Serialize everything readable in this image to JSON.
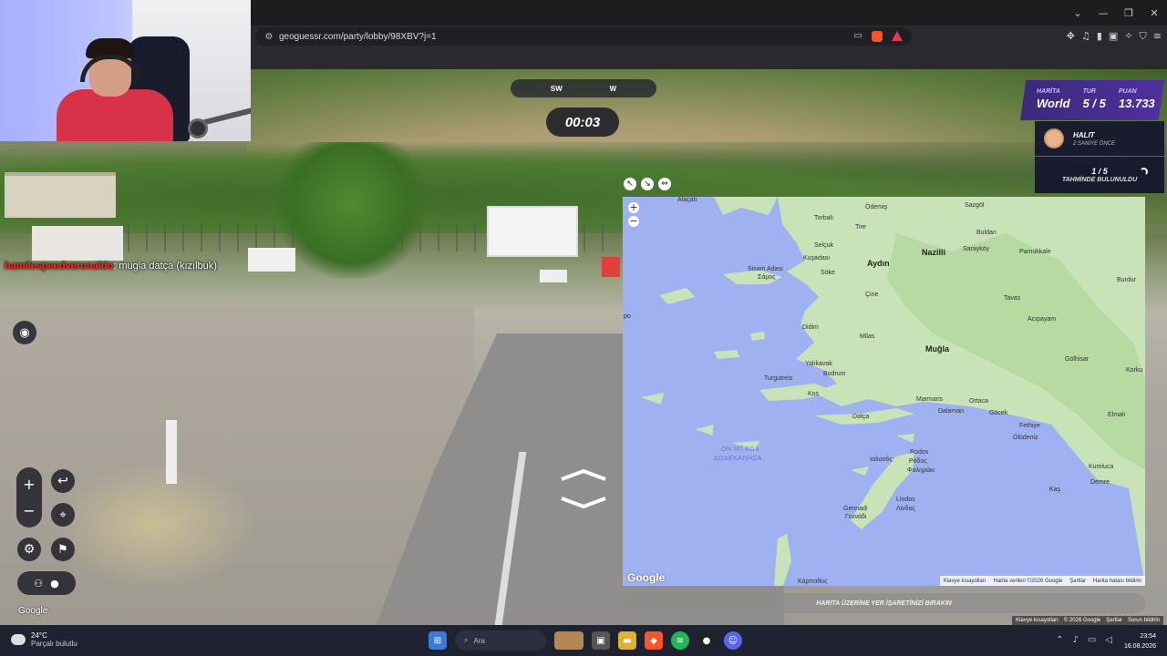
{
  "browser": {
    "url": "geoguessr.com/party/lobby/98XBV?j=1",
    "window_controls": [
      "⌄",
      "—",
      "❐",
      "✕"
    ],
    "shield_badge": "9",
    "ext_icons": [
      "puzzle-icon",
      "music-icon",
      "sidebar-icon",
      "wallet-icon",
      "sparkle-icon",
      "shield-icon",
      "menu-icon"
    ]
  },
  "game": {
    "compass": [
      "SW",
      "W"
    ],
    "timer": "00:03",
    "hud": {
      "map_label": "HARİTA",
      "map_value": "World",
      "round_label": "TUR",
      "round_value": "5 / 5",
      "score_label": "PUAN",
      "score_value": "13.733"
    },
    "player": {
      "name": "HALIT",
      "time": "2 SANİYE ÖNCE"
    },
    "guesses": {
      "count": "1 / 5",
      "label": "TAHMİNDE BULUNULDU"
    },
    "place_button": "HARİTA ÜZERİNE YER İŞARETİNİZİ BIRAKIN",
    "street_google": "Google",
    "street_footer": [
      "Klavye kısayolları",
      "© 2026 Google",
      "Şartlar",
      "Sorun bildirin"
    ]
  },
  "chat": {
    "user": "hamilespeedveronaldo",
    "message": ": mugla datça (kızılbuk)"
  },
  "map": {
    "google": "Google",
    "footer": [
      "Klavye kısayolları",
      "Harita verileri ©2026 Google",
      "Şartlar",
      "Harita hatası bildirin"
    ],
    "labels": {
      "alacati": "Alaçatı",
      "odemis": "Ödemiş",
      "sazgol": "Sazgöl",
      "torbali": "Torbalı",
      "tire": "Tire",
      "buldan": "Buldan",
      "selcuk": "Selçuk",
      "nazilli": "Nazilli",
      "sarayköy": "Sarayköy",
      "pamukkale": "Pamukkale",
      "kusadasi": "Kuşadası",
      "aydin": "Aydın",
      "sisam": "Sisam Adası",
      "samos": "Σάμος",
      "soke": "Söke",
      "burdur": "Burdur",
      "cine": "Çine",
      "tavas": "Tavas",
      "didim": "Didim",
      "acipayam": "Acıpayam",
      "milas": "Milas",
      "yalikavak": "Yalıkavak",
      "mugla": "Muğla",
      "golhisar": "Gölhisar",
      "turgutreis": "Turgutreis",
      "bodrum": "Bodrum",
      "korkuteli": "Korku",
      "kos": "Kos",
      "marmaris": "Marmaris",
      "ortaca": "Ortaca",
      "dalaman": "Dalaman",
      "datca": "Datça",
      "gocek": "Göcek",
      "elmali": "Elmalı",
      "fethiye": "Fethiye",
      "oludeniz": "Ölüdeniz",
      "onikiada": "ON İKİ ADA",
      "dodekanisa": "ΔΩΔΕΚΑΝΗΣΑ",
      "rodos": "Rodos",
      "rodos_gr": "Ρόδος",
      "ialysos": "Ιαλυσός",
      "faliraki": "Φαληράκι",
      "kumluca": "Kumluca",
      "kas": "Kaş",
      "demre": "Demre",
      "lindos": "Lindos",
      "lindos_gr": "Λίνδος",
      "gennadi": "Gennadi",
      "gennadi_gr": "Γεννάδι",
      "karpathos": "Κάρπαθος",
      "po": "po"
    }
  },
  "taskbar": {
    "temp": "24°C",
    "weather": "Parçalı bulutlu",
    "search": "Ara",
    "time": "23:54",
    "date": "16.08.2026"
  }
}
